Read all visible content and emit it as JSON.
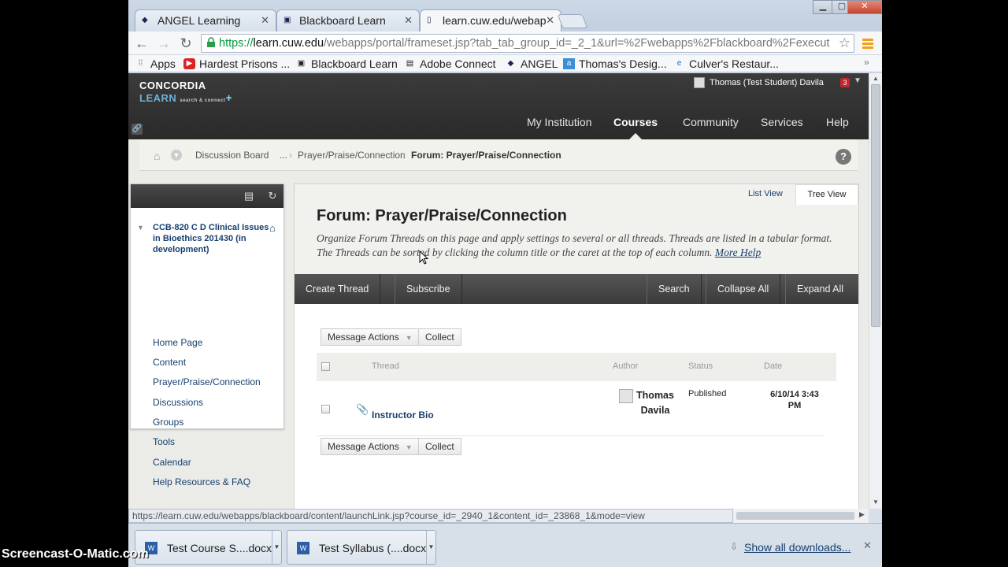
{
  "browser": {
    "tabs": [
      {
        "label": "ANGEL Learning",
        "icon": "cuw-icon"
      },
      {
        "label": "Blackboard Learn",
        "icon": "blackboard-icon"
      },
      {
        "label": "learn.cuw.edu/webap",
        "icon": "page-icon"
      }
    ],
    "url_scheme": "https://",
    "url_host": "learn.cuw.edu",
    "url_path": "/webapps/portal/frameset.jsp?tab_tab_group_id=_2_1&url=%2Fwebapps%2Fblackboard%2Fexecut",
    "bookmarks": [
      "Apps",
      "Hardest Prisons ...",
      "Blackboard Learn",
      "Adobe Connect",
      "ANGEL",
      "Thomas's Desig...",
      "Culver's Restaur..."
    ],
    "status_url": "https://learn.cuw.edu/webapps/blackboard/content/launchLink.jsp?course_id=_2940_1&content_id=_23868_1&mode=view",
    "downloads": [
      "Test Course S....docx",
      "Test Syllabus (....docx"
    ],
    "show_all_downloads": "Show all downloads..."
  },
  "header": {
    "logo_line1": "CONCORDIA",
    "logo_line2": "LEARN",
    "logo_tagline": "search & connect",
    "logo_plus": "+",
    "user_name": "Thomas (Test Student) Davila",
    "notification_count": "3",
    "nav": [
      "My Institution",
      "Courses",
      "Community",
      "Services",
      "Help"
    ],
    "active_nav": "Courses"
  },
  "breadcrumb": {
    "items": [
      "Discussion Board",
      "...",
      "Prayer/Praise/Connection"
    ],
    "current": "Forum: Prayer/Praise/Connection"
  },
  "course_menu": {
    "title": "CCB-820 C D Clinical Issues in Bioethics 201430 (in development)",
    "items": [
      "Home Page",
      "Content",
      "Prayer/Praise/Connection",
      "Discussions",
      "Groups",
      "Tools",
      "Calendar",
      "Help Resources & FAQ"
    ]
  },
  "forum": {
    "view_list": "List View",
    "view_tree": "Tree View",
    "title": "Forum: Prayer/Praise/Connection",
    "description": "Organize Forum Threads on this page and apply settings to several or all threads. Threads are listed in a tabular format. The Threads can be sorted by clicking the column title or the caret at the top of each column.",
    "more_help": "More Help",
    "actions_left": [
      "Create Thread",
      "Subscribe"
    ],
    "actions_right": [
      "Search",
      "Collapse All",
      "Expand All"
    ],
    "message_actions": "Message Actions",
    "collect": "Collect",
    "columns": {
      "thread": "Thread",
      "author": "Author",
      "status": "Status",
      "date": "Date"
    },
    "rows": [
      {
        "thread": "Instructor Bio",
        "author": "Thomas Davila",
        "status": "Published",
        "date": "6/10/14 3:43 PM"
      }
    ]
  },
  "watermark": "Screencast-O-Matic.com"
}
